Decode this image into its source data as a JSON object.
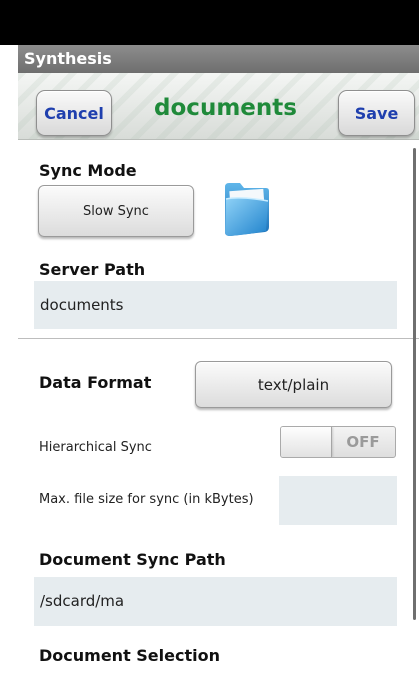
{
  "app_bar": {
    "title": "Synthesis"
  },
  "header": {
    "cancel_label": "Cancel",
    "title": "documents",
    "save_label": "Save"
  },
  "form": {
    "sync_mode": {
      "label": "Sync Mode",
      "value": "Slow Sync"
    },
    "server_path": {
      "label": "Server Path",
      "value": "documents"
    },
    "data_format": {
      "label": "Data Format",
      "value": "text/plain"
    },
    "hierarchical_sync": {
      "label": "Hierarchical Sync",
      "state": "OFF"
    },
    "max_file_size": {
      "label": "Max. file size for sync (in kBytes)",
      "value": ""
    },
    "document_sync_path": {
      "label": "Document Sync Path",
      "value": "/sdcard/ma"
    },
    "document_selection": {
      "label": "Document Selection"
    }
  },
  "icons": {
    "folder": "folder-icon"
  },
  "colors": {
    "accent_title": "#1f8a3a",
    "button_text": "#1f3fae",
    "field_bg": "#e6ecef"
  }
}
